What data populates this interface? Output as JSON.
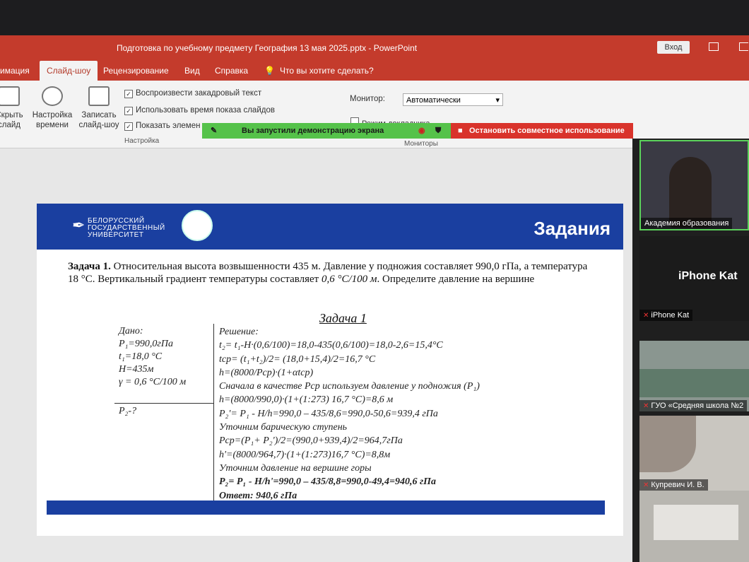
{
  "window": {
    "title": "Подготовка по учебному предмету География  13 мая 2025.pptx  -  PowerPoint",
    "signin_label": "Вход"
  },
  "tabs": [
    {
      "label": "имация"
    },
    {
      "label": "Слайд-шоу",
      "active": true
    },
    {
      "label": "Рецензирование"
    },
    {
      "label": "Вид"
    },
    {
      "label": "Справка"
    },
    {
      "label": "Что вы хотите сделать?"
    }
  ],
  "ribbon": {
    "hide_slide": "Скрыть\nслайд",
    "rehearse": "Настройка\nвремени",
    "record": "Записать\nслайд-шоу",
    "checkboxes": [
      "Воспроизвести закадровый текст",
      "Использовать время показа слайдов",
      "Показать элемен"
    ],
    "group_setup": "Настройка",
    "monitor_label": "Монитор:",
    "monitor_value": "Автоматически",
    "presenter_view": "Режим докладчика",
    "group_monitors": "Мониторы"
  },
  "share": {
    "status": "Вы запустили демонстрацию экрана",
    "stop": "Остановить совместное использование"
  },
  "slide": {
    "university": [
      "БЕЛОРУССКИЙ",
      "ГОСУДАРСТВЕННЫЙ",
      "УНИВЕРСИТЕТ"
    ],
    "header_title": "Задания",
    "task_label": "Задача 1.",
    "task_text": " Относительная высота возвышенности 435 м. Давление у подножия составляет 990,0 гПа, а температура 18 °С. Вертикальный градиент температуры составляет ",
    "task_gradient": "0,6 °С/100 м",
    "task_end": ". Определите давление на вершине",
    "solution_title": "Задача 1",
    "given": [
      "Дано:",
      "P₁=990,0гПа",
      "t₁=18,0 °С",
      "H=435м",
      "γ = 0,6 °С/100 м"
    ],
    "find": "P₂-?",
    "solution_lines": [
      "Решение:",
      "t₂= t₁-H·(0,6/100)=18,0-435(0,6/100)=18,0-2,6=15,4°С",
      "tср= (t₁+t₂)/2= (18,0+15,4)/2=16,7 °С",
      "h=(8000/Pср)·(1+αtср)",
      "Сначала в качестве Pср используем давление у подножия (P₁)",
      "h=(8000/990,0)·(1+(1:273) 16,7 °С)=8,6 м",
      "P₂'= P₁ - H/h=990,0 – 435/8,6=990,0-50,6=939,4 гПа",
      "Уточним барическую ступень",
      "Pср=(P₁+ P₂')/2=(990,0+939,4)/2=964,7гПа",
      "h'=(8000/964,7)·(1+(1:273)16,7 °С)=8,8м",
      "Уточним давление на вершине горы",
      "P₂= P₁ - H/h'=990,0 – 435/8,8=990,0-49,4=940,6 гПа",
      "Ответ: 940,6 гПа"
    ]
  },
  "participants": [
    {
      "name": "Академия образования"
    },
    {
      "name": "iPhone Kat",
      "big": "iPhone Kat"
    },
    {
      "name": "ГУО «Средняя школа №2"
    },
    {
      "name": "Купревич И. В."
    }
  ],
  "colors": {
    "ppt_red": "#c43b2c",
    "slide_blue": "#1a3fa0",
    "share_green": "#55c24a",
    "stop_red": "#d9332b"
  }
}
